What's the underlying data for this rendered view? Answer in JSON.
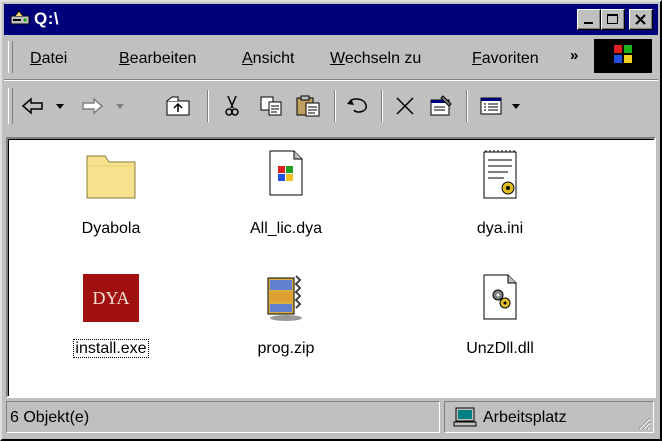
{
  "window": {
    "title": "Q:\\"
  },
  "menubar": {
    "items": [
      {
        "pre": "",
        "ul": "D",
        "post": "atei"
      },
      {
        "pre": "",
        "ul": "B",
        "post": "earbeiten"
      },
      {
        "pre": "",
        "ul": "A",
        "post": "nsicht"
      },
      {
        "pre": "",
        "ul": "W",
        "post": "echseln zu"
      },
      {
        "pre": "",
        "ul": "F",
        "post": "avoriten"
      }
    ],
    "overflow": "»"
  },
  "toolbar": {
    "buttons": [
      "back-icon",
      "forward-icon",
      "up-folder-icon",
      "cut-icon",
      "copy-icon",
      "paste-icon",
      "undo-icon",
      "delete-icon",
      "properties-icon",
      "views-icon"
    ]
  },
  "files": [
    {
      "name": "Dyabola",
      "icon": "folder-icon"
    },
    {
      "name": "All_lic.dya",
      "icon": "windows-file-icon"
    },
    {
      "name": "dya.ini",
      "icon": "ini-settings-icon"
    },
    {
      "name": "install.exe",
      "icon": "dya-logo-icon",
      "badge": "DYA"
    },
    {
      "name": "prog.zip",
      "icon": "zip-archive-icon"
    },
    {
      "name": "UnzDll.dll",
      "icon": "dll-gear-icon"
    }
  ],
  "status": {
    "count": "6 Objekt(e)",
    "location": "Arbeitsplatz"
  },
  "colors": {
    "titlebar": "#00007b",
    "face": "#c0c0c0",
    "badge": "#a01010"
  }
}
